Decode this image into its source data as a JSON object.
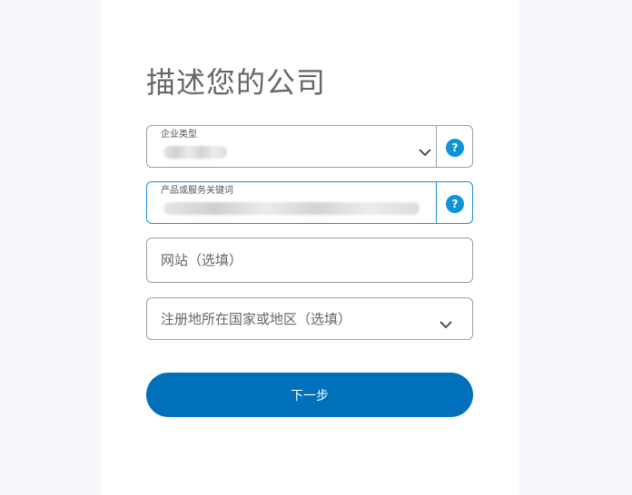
{
  "form": {
    "title": "描述您的公司",
    "business_type": {
      "label": "企业类型",
      "value": "",
      "help": "?"
    },
    "keywords": {
      "label": "产品或服务关键词",
      "value": "",
      "help": "?"
    },
    "website": {
      "placeholder": "网站（选填）"
    },
    "country": {
      "placeholder": "注册地所在国家或地区（选填）"
    },
    "next_button": "下一步"
  },
  "icons": {
    "help": "question-circle-icon",
    "dropdown": "chevron-down-icon"
  },
  "colors": {
    "primary": "#0070ba",
    "help": "#0d94d8",
    "focus_border": "#1a8fd6",
    "page_background": "#f5f7fa"
  }
}
